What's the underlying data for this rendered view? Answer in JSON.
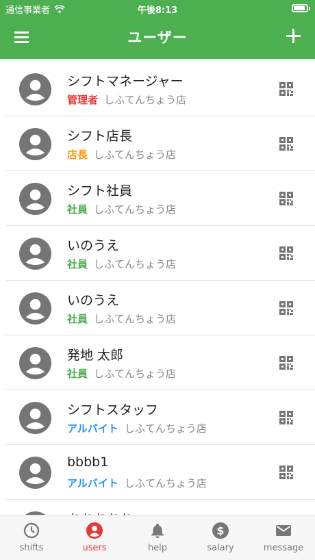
{
  "status_bar": {
    "carrier": "通信事業者",
    "time": "午後8:13"
  },
  "app_bar": {
    "title": "ユーザー"
  },
  "colors": {
    "accent": "#4caf50",
    "role_manager": "#e53935",
    "role_store_manager": "#ff9800",
    "role_employee": "#4caf50",
    "role_part_time": "#2196f3"
  },
  "users": [
    {
      "name": "シフトマネージャー",
      "role": "管理者",
      "role_color": "#e53935",
      "store": "しふてんちょう店"
    },
    {
      "name": "シフト店長",
      "role": "店長",
      "role_color": "#ff9800",
      "store": "しふてんちょう店"
    },
    {
      "name": "シフト社員",
      "role": "社員",
      "role_color": "#4caf50",
      "store": "しふてんちょう店"
    },
    {
      "name": "いのうえ",
      "role": "社員",
      "role_color": "#4caf50",
      "store": "しふてんちょう店"
    },
    {
      "name": "いのうえ",
      "role": "社員",
      "role_color": "#4caf50",
      "store": "しふてんちょう店"
    },
    {
      "name": "発地 太郎",
      "role": "社員",
      "role_color": "#4caf50",
      "store": "しふてんちょう店"
    },
    {
      "name": "シフトスタッフ",
      "role": "アルバイト",
      "role_color": "#2196f3",
      "store": "しふてんちょう店"
    },
    {
      "name": "bbbb1",
      "role": "アルバイト",
      "role_color": "#2196f3",
      "store": "しふてんちょう店"
    },
    {
      "name": "あああああ",
      "role": "",
      "role_color": "#4caf50",
      "store": ""
    }
  ],
  "tabs": [
    {
      "label": "shifts",
      "icon": "clock-icon",
      "active": false
    },
    {
      "label": "users",
      "icon": "person-icon",
      "active": true
    },
    {
      "label": "help",
      "icon": "bell-icon",
      "active": false
    },
    {
      "label": "salary",
      "icon": "dollar-icon",
      "active": false
    },
    {
      "label": "message",
      "icon": "mail-icon",
      "active": false
    }
  ]
}
